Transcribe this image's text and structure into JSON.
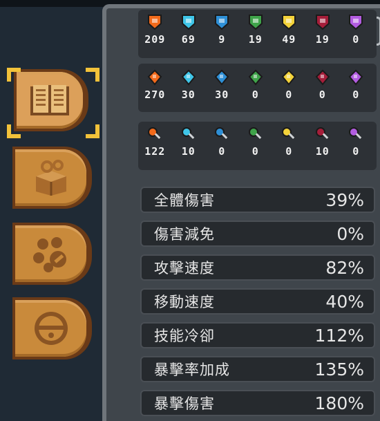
{
  "tabs": [
    {
      "name": "tab-stats",
      "icon": "book-icon",
      "active": true
    },
    {
      "name": "tab-items",
      "icon": "box-swirl-icon",
      "active": false
    },
    {
      "name": "tab-collection",
      "icon": "orbs-scroll-icon",
      "active": false
    },
    {
      "name": "tab-pets",
      "icon": "bell-icon",
      "active": false
    }
  ],
  "elements": {
    "order": [
      "fire",
      "ice",
      "lightning",
      "poison",
      "light",
      "dark",
      "arcane"
    ],
    "colors": {
      "fire": "#f26a1b",
      "ice": "#3fc5e8",
      "lightning": "#2e8fd6",
      "poison": "#3fa34a",
      "light": "#f3d23a",
      "dark": "#a51e3a",
      "arcane": "#b25ce0"
    },
    "shields": [
      "209",
      "69",
      "9",
      "19",
      "49",
      "19",
      "0"
    ],
    "powers": [
      "270",
      "30",
      "30",
      "0",
      "0",
      "0",
      "0"
    ],
    "weapons": [
      "122",
      "10",
      "0",
      "0",
      "0",
      "10",
      "0"
    ]
  },
  "stats": [
    {
      "label": "全體傷害",
      "value": "39%"
    },
    {
      "label": "傷害減免",
      "value": "0%"
    },
    {
      "label": "攻擊速度",
      "value": "82%"
    },
    {
      "label": "移動速度",
      "value": "40%"
    },
    {
      "label": "技能冷卻",
      "value": "112%"
    },
    {
      "label": "暴擊率加成",
      "value": "135%"
    },
    {
      "label": "暴擊傷害",
      "value": "180%"
    }
  ]
}
